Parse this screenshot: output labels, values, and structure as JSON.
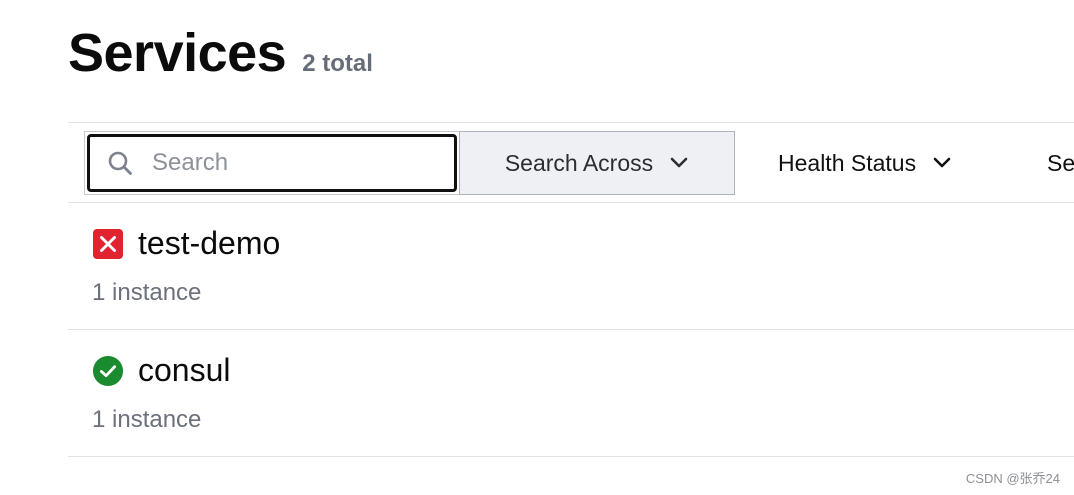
{
  "header": {
    "title": "Services",
    "count": "2 total"
  },
  "toolbar": {
    "search_placeholder": "Search",
    "search_value": "",
    "search_across_label": "Search Across",
    "health_status_label": "Health Status",
    "source_label_partial": "Se"
  },
  "services": [
    {
      "name": "test-demo",
      "instances": "1 instance",
      "status": "critical",
      "status_icon": "x-square-icon",
      "status_color": "#e0232e"
    },
    {
      "name": "consul",
      "instances": "1 instance",
      "status": "passing",
      "status_icon": "check-circle-icon",
      "status_color": "#1a8b2e"
    }
  ],
  "watermark": "CSDN @张乔24",
  "colors": {
    "accent_border": "#111111",
    "muted_text": "#6b707a",
    "dropdown_bg": "#eff0f3"
  }
}
